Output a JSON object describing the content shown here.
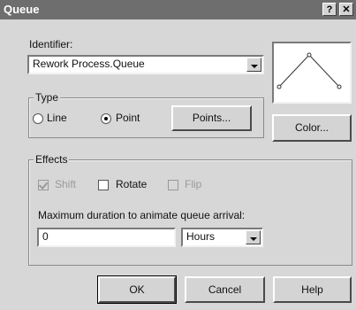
{
  "window": {
    "title": "Queue",
    "help_glyph": "?",
    "close_glyph": "✕"
  },
  "identifier": {
    "label": "Identifier:",
    "value": "Rework Process.Queue"
  },
  "type": {
    "group_label": "Type",
    "options": [
      {
        "label": "Line",
        "selected": false
      },
      {
        "label": "Point",
        "selected": true
      }
    ],
    "points_button": "Points..."
  },
  "color_button": "Color...",
  "effects": {
    "group_label": "Effects",
    "shift": {
      "label": "Shift",
      "checked": true,
      "enabled": false
    },
    "rotate": {
      "label": "Rotate",
      "checked": false,
      "enabled": true
    },
    "flip": {
      "label": "Flip",
      "checked": false,
      "enabled": false
    },
    "duration_label": "Maximum duration to animate queue arrival:",
    "duration_value": "0",
    "unit_value": "Hours"
  },
  "buttons": {
    "ok": "OK",
    "cancel": "Cancel",
    "help": "Help"
  }
}
